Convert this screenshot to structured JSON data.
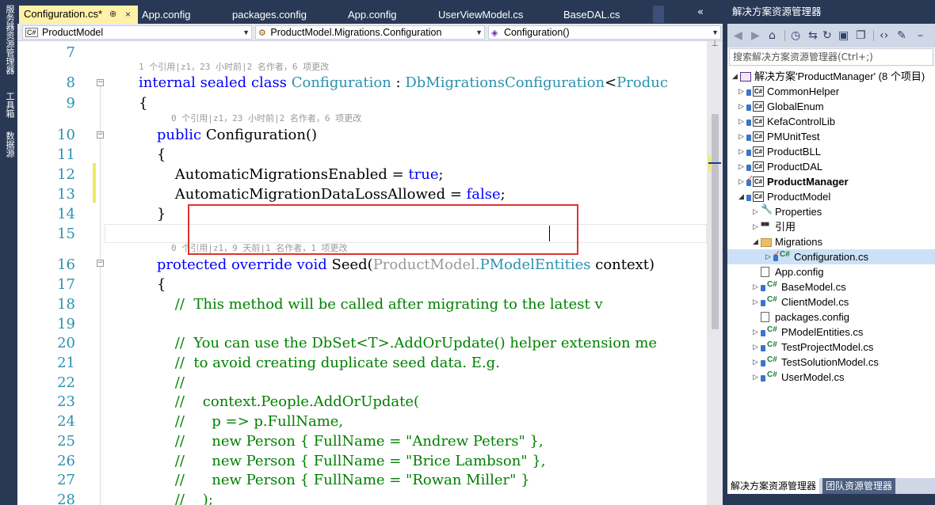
{
  "left_strip": {
    "items": [
      "服务器资源管理器",
      "工具箱",
      "数据源"
    ]
  },
  "tabs": [
    {
      "label": "Configuration.cs*",
      "active": true
    },
    {
      "label": "App.config"
    },
    {
      "label": "packages.config"
    },
    {
      "label": "App.config"
    },
    {
      "label": "UserViewModel.cs"
    },
    {
      "label": "BaseDAL.cs"
    }
  ],
  "tab_overflow": "«",
  "tab_pin": "⊕",
  "tab_close": "×",
  "navbar": {
    "project": "ProductModel",
    "class": "ProductModel.Migrations.Configuration",
    "member": "Configuration()",
    "project_icon": "C#"
  },
  "lines": [
    {
      "num": "7",
      "parts": []
    },
    {
      "num": "8",
      "parts": [
        [
          "kw",
          "internal "
        ],
        [
          "kw",
          "sealed "
        ],
        [
          "kw",
          "class "
        ],
        [
          "ty",
          "Configuration"
        ],
        [
          "pl",
          " : "
        ],
        [
          "ty",
          "DbMigrationsConfiguration"
        ],
        [
          "pl",
          "<"
        ],
        [
          "ty",
          "Produc"
        ]
      ]
    },
    {
      "num": "9",
      "parts": [
        [
          "pl",
          "{"
        ]
      ]
    },
    {
      "num": "10",
      "parts": [
        [
          "pl",
          "    "
        ],
        [
          "kw",
          "public "
        ],
        [
          "pl",
          "Configuration()"
        ]
      ]
    },
    {
      "num": "11",
      "parts": [
        [
          "pl",
          "    {"
        ]
      ]
    },
    {
      "num": "12",
      "parts": [
        [
          "pl",
          "        AutomaticMigrationsEnabled = "
        ],
        [
          "kw",
          "true"
        ],
        [
          "pl",
          ";"
        ]
      ]
    },
    {
      "num": "13",
      "parts": [
        [
          "pl",
          "        AutomaticMigrationDataLossAllowed = "
        ],
        [
          "kw",
          "false"
        ],
        [
          "pl",
          ";"
        ]
      ]
    },
    {
      "num": "14",
      "parts": [
        [
          "pl",
          "    }"
        ]
      ]
    },
    {
      "num": "15",
      "parts": []
    },
    {
      "num": "16",
      "parts": [
        [
          "pl",
          "    "
        ],
        [
          "kw",
          "protected "
        ],
        [
          "kw",
          "override "
        ],
        [
          "kw",
          "void "
        ],
        [
          "pl",
          "Seed("
        ],
        [
          "gr",
          "ProductModel."
        ],
        [
          "ty",
          "PModelEntities"
        ],
        [
          "pl",
          " context)"
        ]
      ]
    },
    {
      "num": "17",
      "parts": [
        [
          "pl",
          "    {"
        ]
      ]
    },
    {
      "num": "18",
      "parts": [
        [
          "pl",
          "        "
        ],
        [
          "cm",
          "//  This method will be called after migrating to the latest v"
        ]
      ]
    },
    {
      "num": "19",
      "parts": []
    },
    {
      "num": "20",
      "parts": [
        [
          "pl",
          "        "
        ],
        [
          "cm",
          "//  You can use the DbSet<T>.AddOrUpdate() helper extension me"
        ]
      ]
    },
    {
      "num": "21",
      "parts": [
        [
          "pl",
          "        "
        ],
        [
          "cm",
          "//  to avoid creating duplicate seed data. E.g."
        ]
      ]
    },
    {
      "num": "22",
      "parts": [
        [
          "pl",
          "        "
        ],
        [
          "cm",
          "//"
        ]
      ]
    },
    {
      "num": "23",
      "parts": [
        [
          "pl",
          "        "
        ],
        [
          "cm",
          "//    context.People.AddOrUpdate("
        ]
      ]
    },
    {
      "num": "24",
      "parts": [
        [
          "pl",
          "        "
        ],
        [
          "cm",
          "//      p => p.FullName,"
        ]
      ]
    },
    {
      "num": "25",
      "parts": [
        [
          "pl",
          "        "
        ],
        [
          "cm",
          "//      new Person { FullName = \"Andrew Peters\" },"
        ]
      ]
    },
    {
      "num": "26",
      "parts": [
        [
          "pl",
          "        "
        ],
        [
          "cm",
          "//      new Person { FullName = \"Brice Lambson\" },"
        ]
      ]
    },
    {
      "num": "27",
      "parts": [
        [
          "pl",
          "        "
        ],
        [
          "cm",
          "//      new Person { FullName = \"Rowan Miller\" }"
        ]
      ]
    },
    {
      "num": "28",
      "parts": [
        [
          "pl",
          "        "
        ],
        [
          "cm",
          "//    );"
        ]
      ]
    }
  ],
  "codelens": [
    {
      "after_line": "7",
      "text": "1 个引用|z1，23 小时前|2 名作者，6 项更改"
    },
    {
      "after_line": "9",
      "text": "0 个引用|z1，23 小时前|2 名作者，6 项更改"
    },
    {
      "after_line": "15",
      "text": "0 个引用|z1，9 天前|1 名作者，1 项更改"
    }
  ],
  "solution_explorer": {
    "title": "解决方案资源管理器",
    "search_placeholder": "搜索解决方案资源管理器(Ctrl+;)",
    "tree": [
      {
        "label": "解决方案'ProductManager' (8 个项目)",
        "level": 0,
        "icon": "sol",
        "arrow": "◢"
      },
      {
        "label": "CommonHelper",
        "level": 1,
        "icon": "cs",
        "arrow": "▷"
      },
      {
        "label": "GlobalEnum",
        "level": 1,
        "icon": "cs",
        "arrow": "▷"
      },
      {
        "label": "KefaControlLib",
        "level": 1,
        "icon": "cs",
        "arrow": "▷"
      },
      {
        "label": "PMUnitTest",
        "level": 1,
        "icon": "cs",
        "arrow": "▷"
      },
      {
        "label": "ProductBLL",
        "level": 1,
        "icon": "cs",
        "arrow": "▷"
      },
      {
        "label": "ProductDAL",
        "level": 1,
        "icon": "cs",
        "arrow": "▷"
      },
      {
        "label": "ProductManager",
        "level": 1,
        "icon": "cs",
        "arrow": "▷",
        "bold": true,
        "check": true
      },
      {
        "label": "ProductModel",
        "level": 1,
        "icon": "cs",
        "arrow": "◢"
      },
      {
        "label": "Properties",
        "level": 2,
        "icon": "wrench",
        "arrow": "▷"
      },
      {
        "label": "引用",
        "level": 2,
        "icon": "refs",
        "arrow": "▷"
      },
      {
        "label": "Migrations",
        "level": 2,
        "icon": "folder",
        "arrow": "◢"
      },
      {
        "label": "Configuration.cs",
        "level": 3,
        "icon": "csfile",
        "arrow": "▷",
        "selected": true,
        "check": true
      },
      {
        "label": "App.config",
        "level": 2,
        "icon": "doc",
        "arrow": ""
      },
      {
        "label": "BaseModel.cs",
        "level": 2,
        "icon": "csfile",
        "arrow": "▷"
      },
      {
        "label": "ClientModel.cs",
        "level": 2,
        "icon": "csfile",
        "arrow": "▷"
      },
      {
        "label": "packages.config",
        "level": 2,
        "icon": "doc",
        "arrow": ""
      },
      {
        "label": "PModelEntities.cs",
        "level": 2,
        "icon": "csfile",
        "arrow": "▷"
      },
      {
        "label": "TestProjectModel.cs",
        "level": 2,
        "icon": "csfile",
        "arrow": "▷"
      },
      {
        "label": "TestSolutionModel.cs",
        "level": 2,
        "icon": "csfile",
        "arrow": "▷"
      },
      {
        "label": "UserModel.cs",
        "level": 2,
        "icon": "csfile",
        "arrow": "▷"
      }
    ],
    "bottom_tabs": [
      {
        "label": "解决方案资源管理器",
        "active": true
      },
      {
        "label": "团队资源管理器",
        "active": false
      }
    ]
  },
  "colors": {
    "keyword": "#0000ff",
    "type": "#2b91af",
    "comment": "#008000",
    "highlight_box": "#d93534",
    "chrome": "#293955",
    "active_tab": "#fff1a8"
  }
}
